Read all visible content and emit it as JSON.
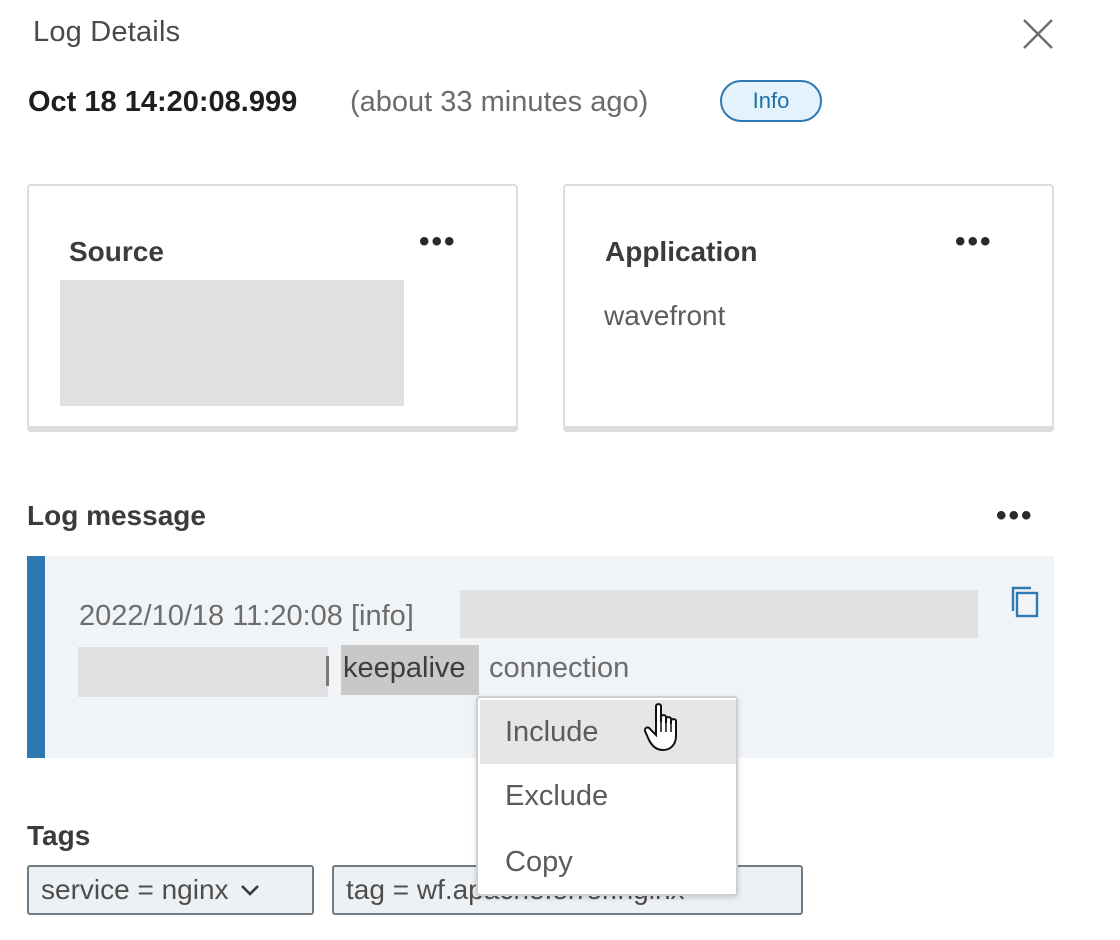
{
  "panel": {
    "title": "Log Details"
  },
  "header": {
    "timestamp": "Oct 18 14:20:08.999",
    "relative_time": "(about 33 minutes ago)",
    "level_badge": "Info"
  },
  "cards": {
    "source": {
      "title": "Source"
    },
    "application": {
      "title": "Application",
      "value": "wavefront"
    }
  },
  "log_message": {
    "label": "Log message",
    "line1_prefix": "2022/10/18 11:20:08 [info]",
    "keyword": "keepalive",
    "line2_suffix": "connection"
  },
  "tags": {
    "label": "Tags",
    "items": [
      {
        "text": "service = nginx"
      },
      {
        "text": "tag = wf.apache.error.nginx"
      }
    ]
  },
  "context_menu": {
    "items": [
      {
        "label": "Include",
        "hovered": true
      },
      {
        "label": "Exclude",
        "hovered": false
      },
      {
        "label": "Copy",
        "hovered": false
      }
    ]
  },
  "colors": {
    "accent": "#2f79b3",
    "badge_bg": "#e3f2fb",
    "log_bg": "#f1f4f7",
    "redaction": "#e0dfe2"
  },
  "icons": {
    "close": "close-icon",
    "more": "more-horizontal-icon",
    "copy": "copy-icon",
    "chevron": "chevron-down-icon",
    "cursor": "hand-pointer-cursor"
  }
}
